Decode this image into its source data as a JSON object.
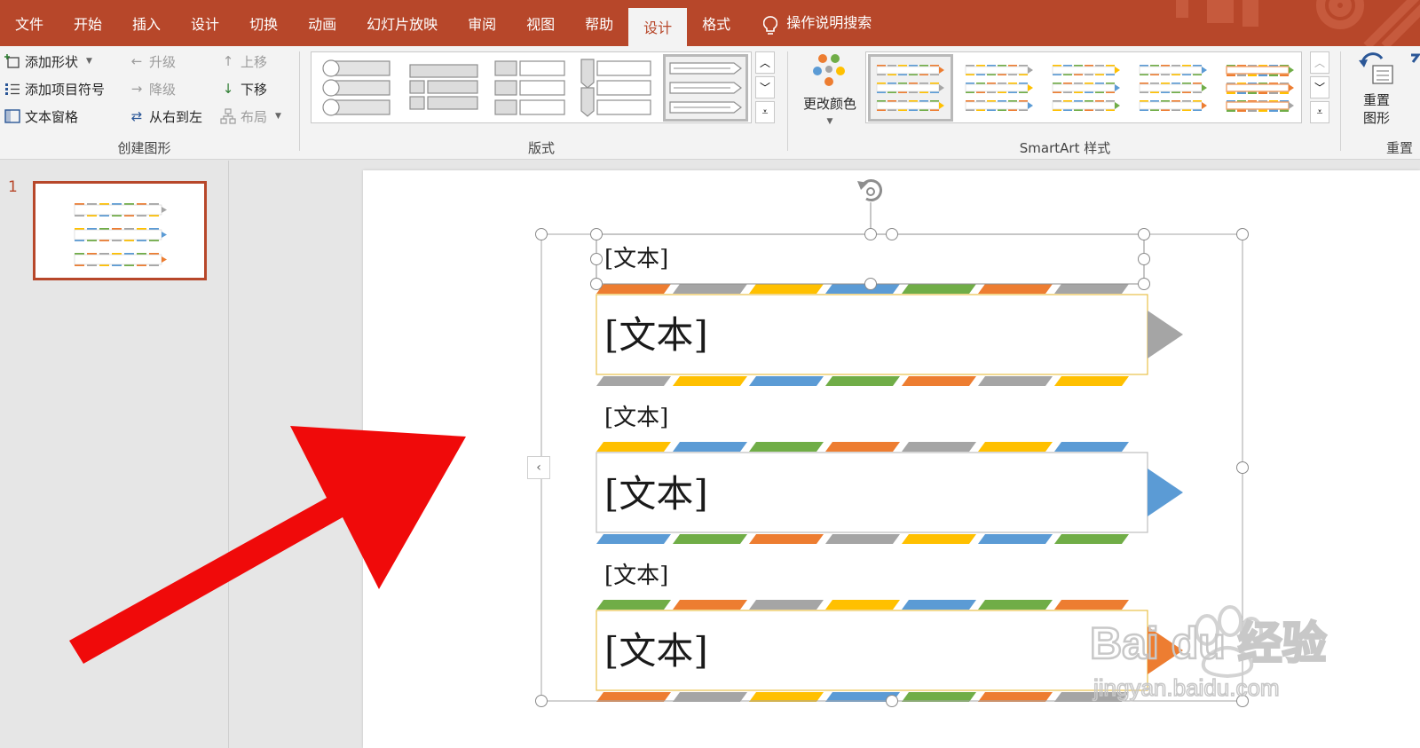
{
  "menu": {
    "tabs": [
      {
        "label": "文件"
      },
      {
        "label": "开始"
      },
      {
        "label": "插入"
      },
      {
        "label": "设计"
      },
      {
        "label": "切换"
      },
      {
        "label": "动画"
      },
      {
        "label": "幻灯片放映"
      },
      {
        "label": "审阅"
      },
      {
        "label": "视图"
      },
      {
        "label": "帮助"
      },
      {
        "label": "设计",
        "active": true
      },
      {
        "label": "格式"
      }
    ],
    "tellme": "操作说明搜索"
  },
  "ribbon": {
    "create_group": {
      "label": "创建图形",
      "add_shape": "添加形状",
      "add_bullet": "添加项目符号",
      "text_pane": "文本窗格",
      "promote": "升级",
      "demote": "降级",
      "right_to_left": "从右到左",
      "move_up": "上移",
      "move_down": "下移",
      "layout": "布局"
    },
    "layouts_group": {
      "label": "版式"
    },
    "styles_group": {
      "label": "SmartArt 样式",
      "change_colors": "更改颜色"
    },
    "reset_group": {
      "label": "重置",
      "reset_graphic_line1": "重置",
      "reset_graphic_line2": "图形"
    }
  },
  "thumbnails": {
    "slide_number": "1"
  },
  "smartart": {
    "items": [
      {
        "level1": "[文本]",
        "level2": "[文本]",
        "arrow_color": "#a5a5a5"
      },
      {
        "level1": "[文本]",
        "level2": "[文本]",
        "arrow_color": "#5b9bd5"
      },
      {
        "level1": "[文本]",
        "level2": "[文本]",
        "arrow_color": "#ed7d31"
      }
    ],
    "stripe_colors": [
      "#ed7d31",
      "#a5a5a5",
      "#ffc000",
      "#5b9bd5",
      "#70ad47"
    ]
  },
  "watermark": {
    "brand_text": "Bai du 经验",
    "url_text": "jingyan.baidu.com"
  },
  "colors": {
    "accent": "#b7472a",
    "annotation_arrow": "#f00a0a"
  }
}
